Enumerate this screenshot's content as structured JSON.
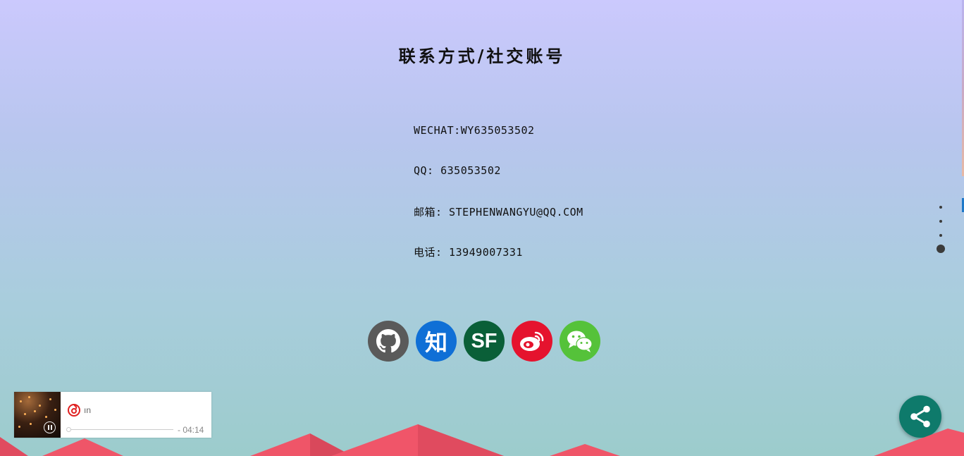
{
  "page": {
    "title": "联系方式/社交账号"
  },
  "contacts": [
    {
      "text": "WECHAT:WY635053502"
    },
    {
      "text": "QQ: 635053502"
    },
    {
      "text": "邮箱: STEPHENWANGYU@QQ.COM"
    },
    {
      "text": "电话: 13949007331"
    }
  ],
  "social": {
    "github": {
      "icon": "github-icon",
      "color": "#5a5a5a"
    },
    "zhihu": {
      "label": "知",
      "icon": "zhihu-icon",
      "color": "#0f6fd6"
    },
    "segmentfault": {
      "label": "SF",
      "icon": "segmentfault-icon",
      "color": "#0a5f38"
    },
    "weibo": {
      "icon": "weibo-icon",
      "color": "#e5132e"
    },
    "wechat": {
      "icon": "wechat-icon",
      "color": "#55c23a"
    }
  },
  "page_nav": {
    "sections": 4,
    "active_index": 3
  },
  "player": {
    "title": "ın",
    "time": "- 04:14",
    "progress": 0,
    "state": "playing",
    "logo": "netease-music-icon"
  },
  "share_button": {
    "icon": "share-icon",
    "color": "#0e7a6b"
  }
}
